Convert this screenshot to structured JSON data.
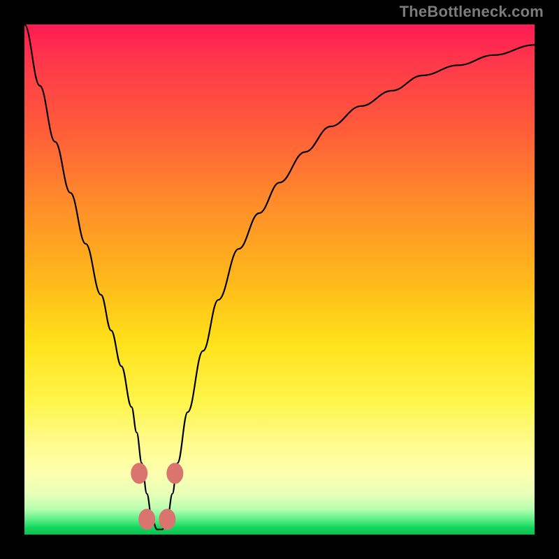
{
  "watermark": "TheBottleneck.com",
  "chart_data": {
    "type": "line",
    "title": "",
    "xlabel": "",
    "ylabel": "",
    "xlim": [
      0,
      100
    ],
    "ylim": [
      0,
      100
    ],
    "curve": {
      "x": [
        0,
        3,
        6,
        9,
        12,
        15,
        17,
        19,
        21,
        22,
        23,
        24,
        25,
        26,
        27,
        28,
        29,
        30,
        32,
        35,
        38,
        42,
        46,
        50,
        55,
        60,
        66,
        72,
        78,
        85,
        92,
        100
      ],
      "y": [
        100,
        88,
        77,
        67,
        57,
        47,
        40,
        33,
        25,
        20,
        14,
        8,
        3,
        1,
        1,
        3,
        8,
        14,
        24,
        36,
        46,
        56,
        63,
        69,
        75,
        80,
        84,
        87,
        90,
        92,
        94,
        96
      ]
    },
    "nubs": [
      {
        "x": 22.5,
        "y": 12
      },
      {
        "x": 29.5,
        "y": 12
      },
      {
        "x": 24.0,
        "y": 3
      },
      {
        "x": 28.0,
        "y": 3
      }
    ],
    "nub_color": "#d9746f",
    "nub_radius": 12
  }
}
